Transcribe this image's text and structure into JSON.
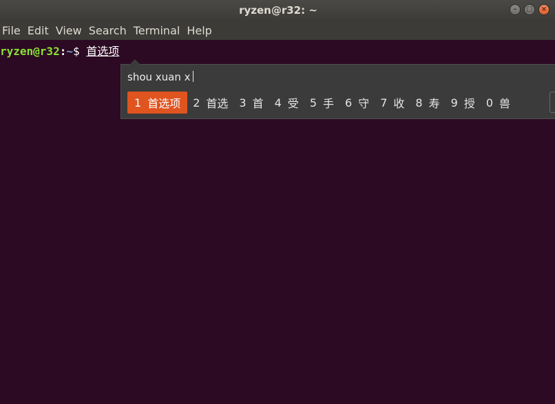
{
  "window": {
    "title": "ryzen@r32: ~"
  },
  "menu": [
    "File",
    "Edit",
    "View",
    "Search",
    "Terminal",
    "Help"
  ],
  "prompt": {
    "user_host": "ryzen@r32",
    "sep": ":",
    "path": "~",
    "symbol": "$ ",
    "preedit": "首选项"
  },
  "ime": {
    "input": "shou xuan x",
    "candidates": [
      {
        "num": "1",
        "text": "首选项"
      },
      {
        "num": "2",
        "text": "首选"
      },
      {
        "num": "3",
        "text": "首"
      },
      {
        "num": "4",
        "text": "受"
      },
      {
        "num": "5",
        "text": "手"
      },
      {
        "num": "6",
        "text": "守"
      },
      {
        "num": "7",
        "text": "收"
      },
      {
        "num": "8",
        "text": "寿"
      },
      {
        "num": "9",
        "text": "授"
      },
      {
        "num": "0",
        "text": "兽"
      }
    ],
    "selected_index": 0,
    "accent_color": "#e05420"
  },
  "colors": {
    "terminal_bg": "#2c0a23",
    "user_host": "#8ae234",
    "path": "#729fcf"
  }
}
